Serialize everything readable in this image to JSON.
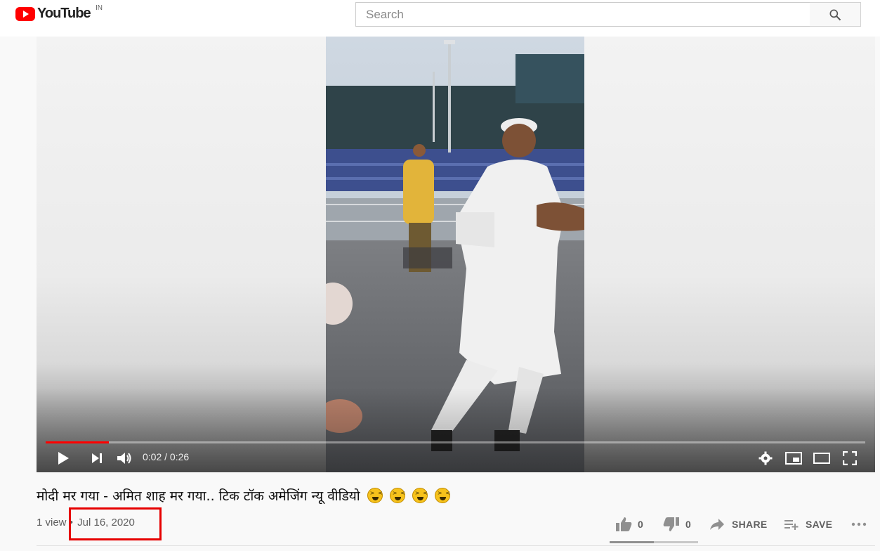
{
  "header": {
    "logo_text": "YouTube",
    "country_code": "IN",
    "search_placeholder": "Search",
    "icons": {
      "search": "search-icon",
      "logo": "youtube-play-icon"
    }
  },
  "player": {
    "current_time": "0:02",
    "duration": "0:26",
    "time_display": "0:02 / 0:26",
    "progress_fraction": 0.077,
    "colors": {
      "progress": "#ff0000"
    },
    "icons": [
      "play-icon",
      "next-icon",
      "volume-icon",
      "settings-icon",
      "miniplayer-icon",
      "theater-mode-icon",
      "fullscreen-icon"
    ]
  },
  "video": {
    "title_text": "मोदी मर गया - अमित शाह मर गया.. टिक टॉक अमेजिंग न्यू वीडियो",
    "title_emoji_count": 4,
    "views": "1 view",
    "separator": "•",
    "date": "Jul 16, 2020"
  },
  "actions": {
    "like_count": "0",
    "dislike_count": "0",
    "share_label": "SHARE",
    "save_label": "SAVE",
    "icons": [
      "thumb-up-icon",
      "thumb-down-icon",
      "share-icon",
      "playlist-add-icon",
      "more-icon"
    ]
  },
  "annotation": {
    "highlight_color": "#e60000"
  }
}
